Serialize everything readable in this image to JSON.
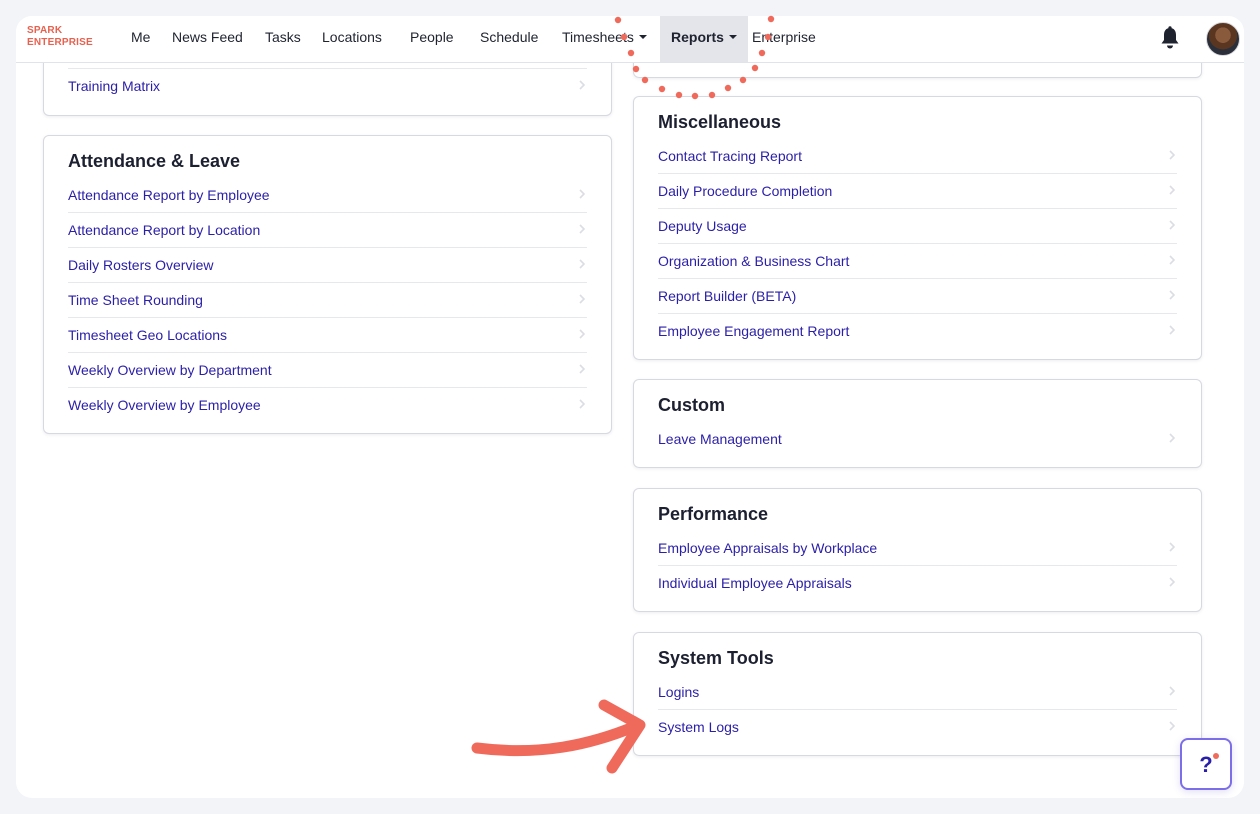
{
  "brand": {
    "line1": "SPARK",
    "line2": "ENTERPRISE"
  },
  "nav": {
    "items": [
      {
        "label": "Me"
      },
      {
        "label": "News Feed"
      },
      {
        "label": "Tasks"
      },
      {
        "label": "Locations"
      },
      {
        "label": "People"
      },
      {
        "label": "Schedule"
      },
      {
        "label": "Timesheets"
      },
      {
        "label": "Reports"
      },
      {
        "label": "Enterprise"
      }
    ],
    "active": "Reports"
  },
  "cards": {
    "training": {
      "items": [
        "Training Matrix"
      ]
    },
    "attendance": {
      "title": "Attendance & Leave",
      "items": [
        "Attendance Report by Employee",
        "Attendance Report by Location",
        "Daily Rosters Overview",
        "Time Sheet Rounding",
        "Timesheet Geo Locations",
        "Weekly Overview by Department",
        "Weekly Overview by Employee"
      ]
    },
    "miscellaneous": {
      "title": "Miscellaneous",
      "items": [
        "Contact Tracing Report",
        "Daily Procedure Completion",
        "Deputy Usage",
        "Organization & Business Chart",
        "Report Builder (BETA)",
        "Employee Engagement Report"
      ]
    },
    "custom": {
      "title": "Custom",
      "items": [
        "Leave Management"
      ]
    },
    "performance": {
      "title": "Performance",
      "items": [
        "Employee Appraisals by Workplace",
        "Individual Employee Appraisals"
      ]
    },
    "system_tools": {
      "title": "System Tools",
      "items": [
        "Logins",
        "System Logs"
      ]
    }
  },
  "help": {
    "label": "?"
  },
  "colors": {
    "brand": "#e8614f",
    "link": "#2a1fa8",
    "annotation": "#f06a5c",
    "help_border": "#7b6ee8",
    "active_nav_bg": "#e4e5ea"
  },
  "icons": {
    "bell": "bell-icon",
    "chevron": "chevron-right-icon",
    "help": "help-icon",
    "caret": "caret-down-icon"
  }
}
